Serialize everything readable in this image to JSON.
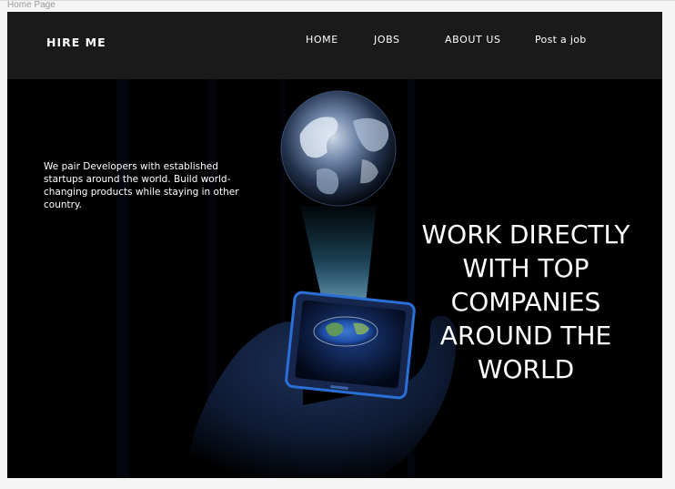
{
  "window": {
    "title": "Home Page"
  },
  "navbar": {
    "brand": "HIRE ME",
    "links": [
      "HOME",
      "JOBS",
      "ABOUT US",
      "Post a job"
    ]
  },
  "hero": {
    "description": "We pair  Developers with established startups around the world. Build world-changing products while staying in other country.",
    "heading": "WORK DIRECTLY WITH TOP COMPANIES AROUND THE WORLD"
  },
  "colors": {
    "navbar_bg": "#1b1a1b",
    "hero_bg": "#000000",
    "text": "#ffffff",
    "accent_blue": "#2a6fd6"
  }
}
